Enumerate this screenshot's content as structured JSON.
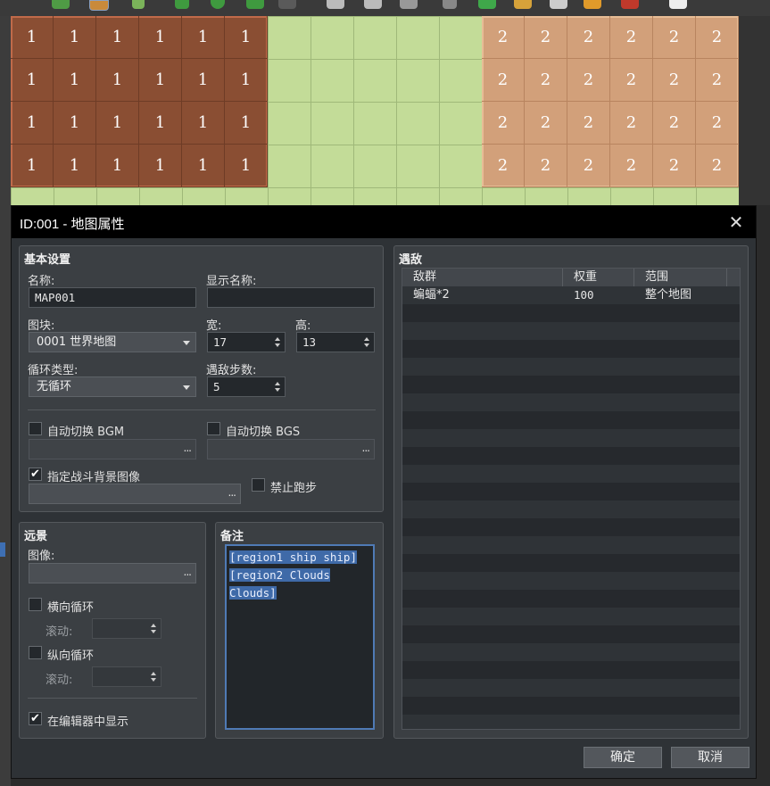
{
  "map": {
    "region_a_label": "1",
    "region_b_label": "2"
  },
  "dialog": {
    "title": "ID:001 - 地图属性",
    "close_glyph": "✕"
  },
  "basic": {
    "section_title": "基本设置",
    "name_label": "名称:",
    "name_value": "MAP001",
    "display_name_label": "显示名称:",
    "display_name_value": "",
    "tileset_label": "图块:",
    "tileset_value": "0001 世界地图",
    "width_label": "宽:",
    "width_value": "17",
    "height_label": "高:",
    "height_value": "13",
    "scroll_type_label": "循环类型:",
    "scroll_type_value": "无循环",
    "enc_steps_label": "遇敌步数:",
    "enc_steps_value": "5",
    "autoplay_bgm_label": "自动切换 BGM",
    "autoplay_bgm_checked": false,
    "autoplay_bgs_label": "自动切换 BGS",
    "autoplay_bgs_checked": false,
    "battleback_label": "指定战斗背景图像",
    "battleback_checked": true,
    "disable_dash_label": "禁止跑步",
    "disable_dash_checked": false,
    "ellipsis": "..."
  },
  "parallax": {
    "section_title": "远景",
    "image_label": "图像:",
    "loop_h_label": "横向循环",
    "loop_h_checked": false,
    "loop_v_label": "纵向循环",
    "loop_v_checked": false,
    "scroll_label": "滚动:",
    "show_in_editor_label": "在编辑器中显示",
    "show_in_editor_checked": true
  },
  "note": {
    "section_title": "备注",
    "lines": [
      "[region1 ship ship]",
      "[region2 Clouds Clouds]"
    ]
  },
  "encounters": {
    "section_title": "遇敌",
    "columns": [
      "敌群",
      "权重",
      "范围"
    ],
    "rows": [
      {
        "troop": "蝙蝠*2",
        "weight": "100",
        "range": "整个地图"
      }
    ]
  },
  "buttons": {
    "ok": "确定",
    "cancel": "取消"
  },
  "colors": {
    "region_a": "#8a4e33",
    "region_b": "#d2a07a",
    "grass": "#c3dc98",
    "selection": "#3f6aa8"
  }
}
